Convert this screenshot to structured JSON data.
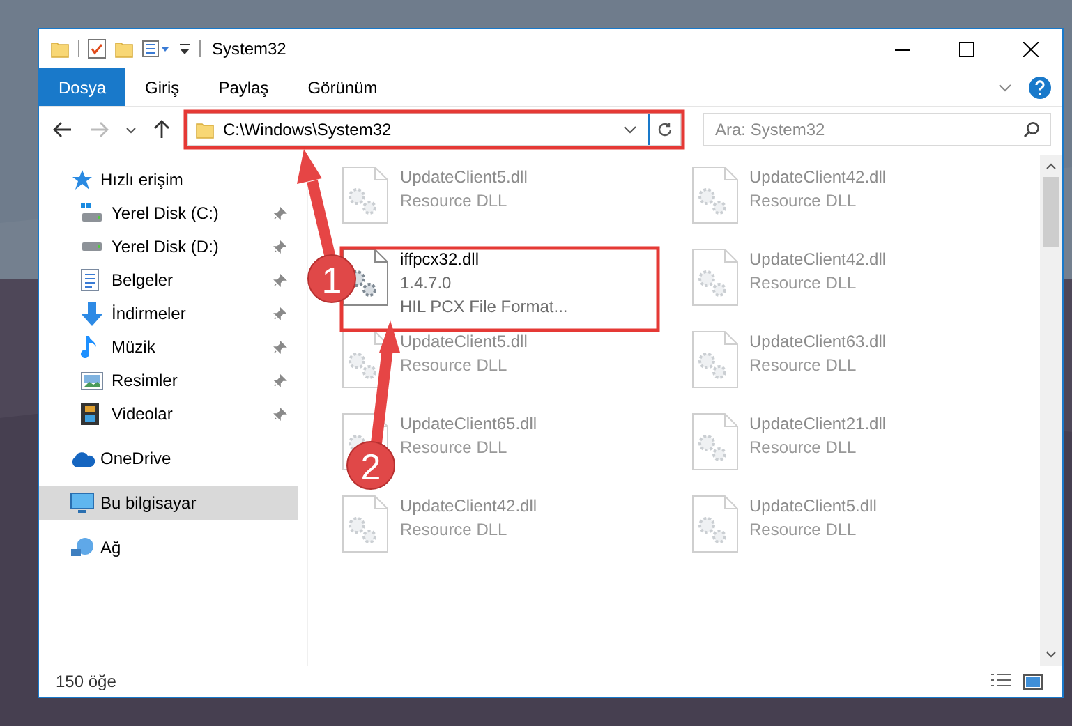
{
  "window": {
    "title": "System32"
  },
  "ribbon_tabs": [
    {
      "label": "Dosya",
      "selected": true
    },
    {
      "label": "Giriş",
      "selected": false
    },
    {
      "label": "Paylaş",
      "selected": false
    },
    {
      "label": "Görünüm",
      "selected": false
    }
  ],
  "address": {
    "path": "C:\\Windows\\System32"
  },
  "search": {
    "placeholder": "Ara: System32"
  },
  "sidebar": {
    "items": [
      {
        "label": "Hızlı erişim",
        "selected": false,
        "children": [
          {
            "label": "Yerel Disk (C:)",
            "pinned": true,
            "selected": false
          },
          {
            "label": "Yerel Disk (D:)",
            "pinned": true,
            "selected": false
          },
          {
            "label": "Belgeler",
            "pinned": true,
            "selected": false
          },
          {
            "label": "İndirmeler",
            "pinned": true,
            "selected": false
          },
          {
            "label": "Müzik",
            "pinned": true,
            "selected": false
          },
          {
            "label": "Resimler",
            "pinned": true,
            "selected": false
          },
          {
            "label": "Videolar",
            "pinned": true,
            "selected": false
          }
        ]
      },
      {
        "label": "OneDrive",
        "selected": false
      },
      {
        "label": "Bu bilgisayar",
        "selected": true
      },
      {
        "label": "Ağ",
        "selected": false
      }
    ]
  },
  "files": [
    {
      "name": "UpdateClient5.dll",
      "details": [
        "Resource DLL"
      ],
      "blurred": true
    },
    {
      "name": "UpdateClient42.dll",
      "details": [
        "Resource DLL"
      ],
      "blurred": true
    },
    {
      "name": "iffpcx32.dll",
      "details": [
        "1.4.7.0",
        "HIL PCX File Format..."
      ],
      "blurred": false
    },
    {
      "name": "UpdateClient42.dll",
      "details": [
        "Resource DLL"
      ],
      "blurred": true
    },
    {
      "name": "UpdateClient5.dll",
      "details": [
        "Resource DLL"
      ],
      "blurred": true
    },
    {
      "name": "UpdateClient63.dll",
      "details": [
        "Resource DLL"
      ],
      "blurred": true
    },
    {
      "name": "UpdateClient65.dll",
      "details": [
        "Resource DLL"
      ],
      "blurred": true
    },
    {
      "name": "UpdateClient21.dll",
      "details": [
        "Resource DLL"
      ],
      "blurred": true
    },
    {
      "name": "UpdateClient42.dll",
      "details": [
        "Resource DLL"
      ],
      "blurred": true
    },
    {
      "name": "UpdateClient5.dll",
      "details": [
        "Resource DLL"
      ],
      "blurred": true
    }
  ],
  "status_bar": {
    "item_count": "150 öğe"
  },
  "annotations": [
    {
      "number": "1"
    },
    {
      "number": "2"
    }
  ]
}
